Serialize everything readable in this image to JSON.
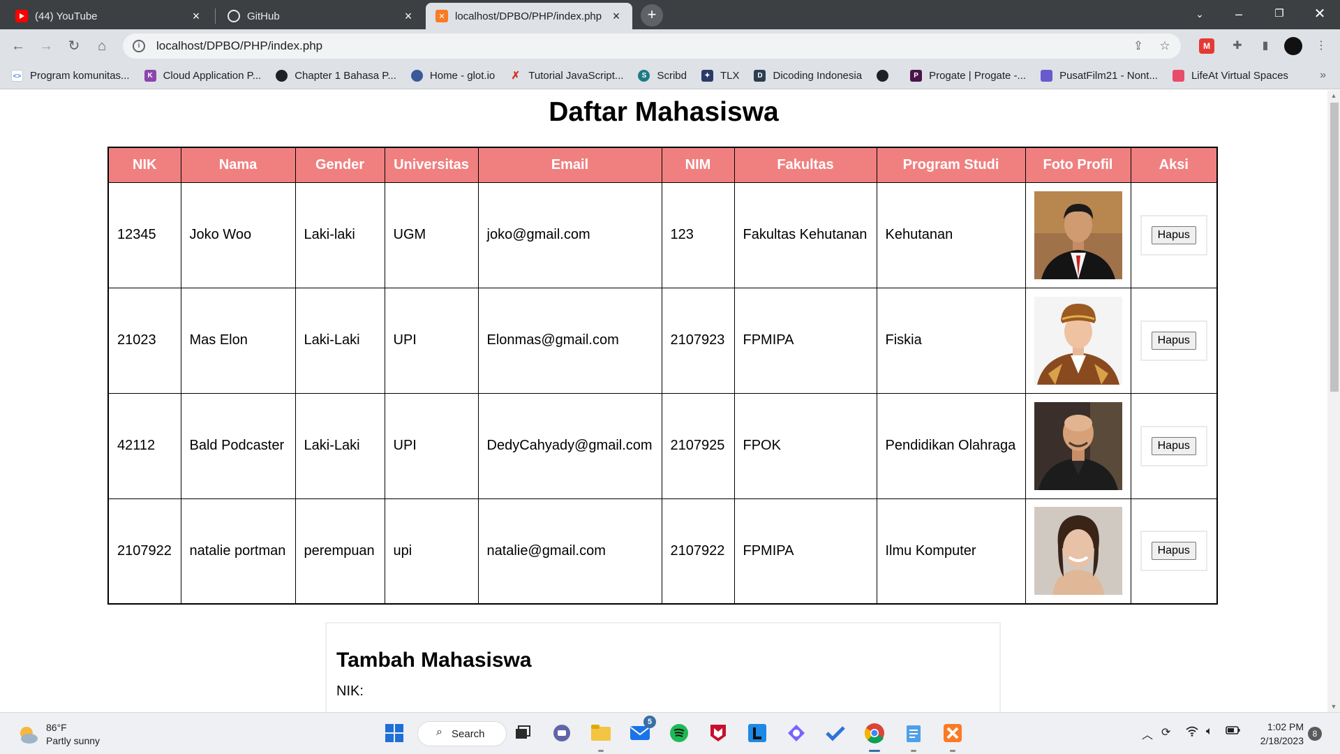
{
  "browser": {
    "tabs": [
      {
        "label": "(44) YouTube",
        "icon": "youtube-icon",
        "active": false
      },
      {
        "label": "GitHub",
        "icon": "github-icon",
        "active": false
      },
      {
        "label": "localhost/DPBO/PHP/index.php",
        "icon": "xampp-icon",
        "active": true
      }
    ],
    "address": "localhost/DPBO/PHP/index.php",
    "bookmarks": [
      {
        "label": "Program komunitas...",
        "icon": "code-icon",
        "color": "#4285f4"
      },
      {
        "label": "Cloud Application P...",
        "icon": "k-icon",
        "color": "#8e44ad"
      },
      {
        "label": "Chapter 1 Bahasa P...",
        "icon": "globe-icon",
        "color": "#202124"
      },
      {
        "label": "Home - glot.io",
        "icon": "glot-icon",
        "color": "#3b5998"
      },
      {
        "label": "Tutorial JavaScript...",
        "icon": "runner-icon",
        "color": "#d93025"
      },
      {
        "label": "Scribd",
        "icon": "scribd-icon",
        "color": "#1e7b85"
      },
      {
        "label": "TLX",
        "icon": "tlx-icon",
        "color": "#2b3a67"
      },
      {
        "label": "Dicoding Indonesia",
        "icon": "dicoding-icon",
        "color": "#2d3e50"
      },
      {
        "label": "",
        "icon": "globe-icon",
        "color": "#202124"
      },
      {
        "label": "Progate | Progate -...",
        "icon": "progate-icon",
        "color": "#4a154b"
      },
      {
        "label": "PusatFilm21 - Nont...",
        "icon": "film-icon",
        "color": "#6a5acd"
      },
      {
        "label": "LifeAt Virtual Spaces",
        "icon": "lifeat-icon",
        "color": "#e94b6b"
      }
    ]
  },
  "page": {
    "title": "Daftar Mahasiswa",
    "table": {
      "headers": [
        "NIK",
        "Nama",
        "Gender",
        "Universitas",
        "Email",
        "NIM",
        "Fakultas",
        "Program Studi",
        "Foto Profil",
        "Aksi"
      ],
      "rows": [
        {
          "nik": "12345",
          "nama": "Joko Woo",
          "gender": "Laki-laki",
          "universitas": "UGM",
          "email": "joko@gmail.com",
          "nim": "123",
          "fakultas": "Fakultas Kehutanan",
          "prodi": "Kehutanan",
          "action": "Hapus"
        },
        {
          "nik": "21023",
          "nama": "Mas Elon",
          "gender": "Laki-Laki",
          "universitas": "UPI",
          "email": "Elonmas@gmail.com",
          "nim": "2107923",
          "fakultas": "FPMIPA",
          "prodi": "Fiskia",
          "action": "Hapus"
        },
        {
          "nik": "42112",
          "nama": "Bald Podcaster",
          "gender": "Laki-Laki",
          "universitas": "UPI",
          "email": "DedyCahyady@gmail.com",
          "nim": "2107925",
          "fakultas": "FPOK",
          "prodi": "Pendidikan Olahraga",
          "action": "Hapus"
        },
        {
          "nik": "2107922",
          "nama": "natalie portman",
          "gender": "perempuan",
          "universitas": "upi",
          "email": "natalie@gmail.com",
          "nim": "2107922",
          "fakultas": "FPMIPA",
          "prodi": "Ilmu Komputer",
          "action": "Hapus"
        }
      ]
    },
    "form": {
      "title": "Tambah Mahasiswa",
      "nik_label": "NIK:"
    }
  },
  "taskbar": {
    "weather_temp": "86°F",
    "weather_desc": "Partly sunny",
    "search_label": "Search",
    "mail_badge": "5",
    "time": "1:02 PM",
    "date": "2/18/2023",
    "notifications": "8"
  }
}
